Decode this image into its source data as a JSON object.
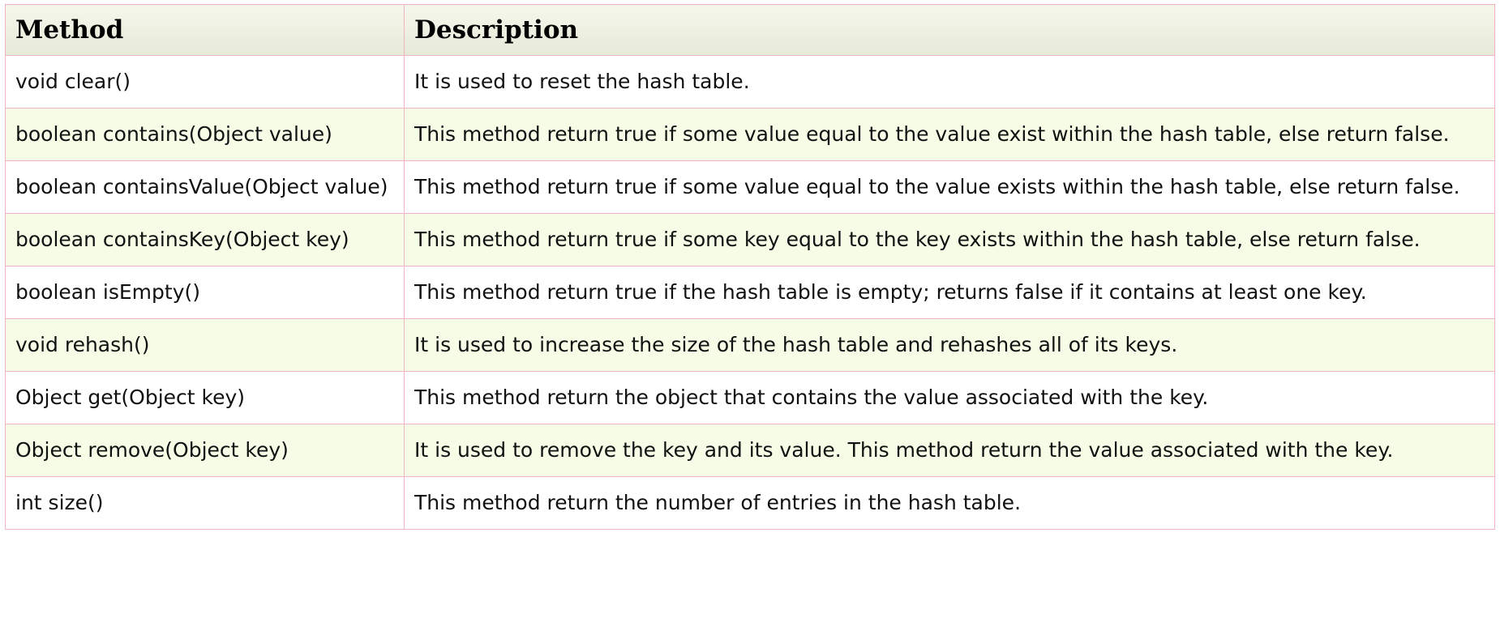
{
  "table": {
    "headers": {
      "method": "Method",
      "description": "Description"
    },
    "rows": [
      {
        "method": "void clear()",
        "description": "It is used to reset the hash table."
      },
      {
        "method": "boolean contains(Object value)",
        "description": "This method return true if some value equal to the value exist within the hash table, else return false."
      },
      {
        "method": "boolean containsValue(Object value)",
        "description": "This method return true if some value equal to the value exists within the hash table, else return false."
      },
      {
        "method": "boolean containsKey(Object key)",
        "description": "This method return true if some key equal to the key exists within the hash table, else return false."
      },
      {
        "method": "boolean isEmpty()",
        "description": "This method return true if the hash table is empty; returns false if it contains at least one key."
      },
      {
        "method": "void rehash()",
        "description": "It is used to increase the size of the hash table and rehashes all of its keys."
      },
      {
        "method": "Object get(Object key)",
        "description": "This method return the object that contains the value associated with the key."
      },
      {
        "method": "Object remove(Object key)",
        "description": "It is used to remove the key and its value. This method return the value associated with the key."
      },
      {
        "method": "int size()",
        "description": "This method return the number of entries in the hash table."
      }
    ]
  },
  "colors": {
    "border": "#f3b3c4",
    "header_bg": "#e6ead7",
    "alt_row_bg": "#f5fde6",
    "plain_row_bg": "#ffffff"
  }
}
